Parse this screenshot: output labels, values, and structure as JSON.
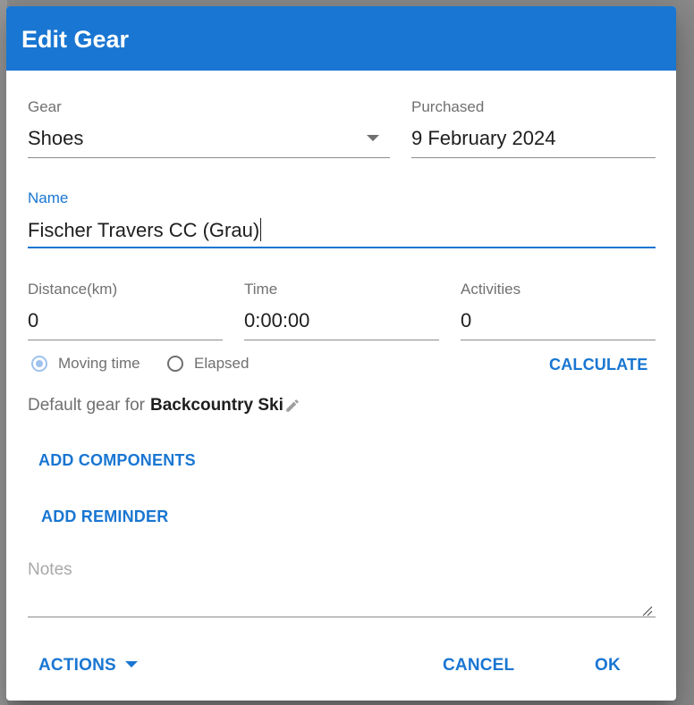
{
  "dialog": {
    "title": "Edit Gear"
  },
  "fields": {
    "gear": {
      "label": "Gear",
      "value": "Shoes"
    },
    "purchased": {
      "label": "Purchased",
      "value": "9 February 2024"
    },
    "name": {
      "label": "Name",
      "value": "Fischer Travers CC (Grau)"
    },
    "distance": {
      "label": "Distance(km)",
      "value": "0"
    },
    "time": {
      "label": "Time",
      "value": "0:00:00"
    },
    "activities": {
      "label": "Activities",
      "value": "0"
    },
    "notes": {
      "placeholder": "Notes",
      "value": ""
    }
  },
  "time_mode": {
    "options": [
      {
        "label": "Moving time",
        "checked": true
      },
      {
        "label": "Elapsed",
        "checked": false
      }
    ]
  },
  "buttons": {
    "calculate": "CALCULATE",
    "add_components": "ADD COMPONENTS",
    "add_reminder": "ADD REMINDER",
    "actions": "ACTIONS",
    "cancel": "CANCEL",
    "ok": "OK"
  },
  "default_gear": {
    "prefix": "Default gear for",
    "activity_type": "Backcountry Ski"
  },
  "icons": {
    "gear_dropdown": "triangle-down-icon",
    "default_gear_edit": "pencil-icon",
    "actions_dropdown": "triangle-down-icon",
    "notes_resize": "resize-grip-icon"
  },
  "colors": {
    "primary": "#1976d2",
    "header_text": "#ffffff",
    "radio_checked": "#9fc1ee",
    "backdrop": "#8a8a8a"
  }
}
